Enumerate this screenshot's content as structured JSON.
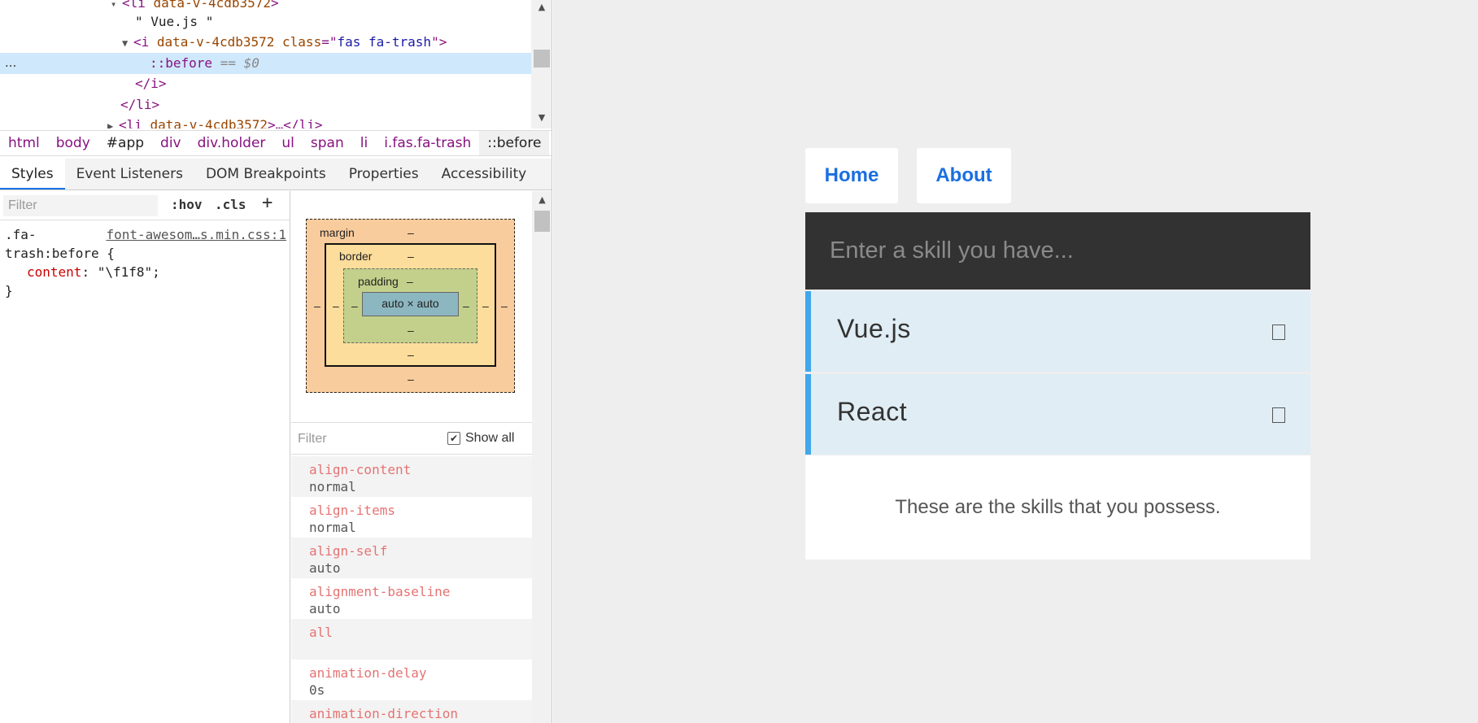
{
  "devtools": {
    "tree": {
      "line0": {
        "tag": "<li ",
        "attr": "data-v-4cdb3572",
        "end": ">"
      },
      "line1": {
        "text": "\" Vue.js \""
      },
      "line2": {
        "open": "<i ",
        "attr1": "data-v-4cdb3572 ",
        "attr2": "class",
        "eq": "=\"",
        "val": "fas fa-trash",
        "close": "\">"
      },
      "line3": {
        "dots": "...",
        "pseudo": "::before",
        "eq": " == ",
        "var": "$0"
      },
      "line4": {
        "text": "</i>"
      },
      "line5": {
        "text": "</li>"
      },
      "line6": {
        "tag": "<li ",
        "attr": "data-v-4cdb3572",
        "end": ">…</li>"
      }
    },
    "breadcrumb": [
      "html",
      "body",
      "#app",
      "div",
      "div.holder",
      "ul",
      "span",
      "li",
      "i.fas.fa-trash",
      "::before"
    ],
    "tabs": [
      "Styles",
      "Event Listeners",
      "DOM Breakpoints",
      "Properties",
      "Accessibility"
    ],
    "styles": {
      "filter_placeholder": "Filter",
      "hov": ":hov",
      "cls": ".cls",
      "add": "+",
      "rule": {
        "selector_line1": ".fa-",
        "selector_line2": "trash:before {",
        "source": "font-awesom…s.min.css:1",
        "prop": "content",
        "value": ": \"\\f1f8\";",
        "close": "}"
      }
    },
    "box_model": {
      "margin": "margin",
      "border": "border",
      "padding": "padding",
      "content": "auto × auto",
      "dash": "–"
    },
    "computed": {
      "filter_placeholder": "Filter",
      "show_all": "Show all",
      "properties": [
        {
          "name": "align-content",
          "value": "normal"
        },
        {
          "name": "align-items",
          "value": "normal"
        },
        {
          "name": "align-self",
          "value": "auto"
        },
        {
          "name": "alignment-baseline",
          "value": "auto"
        },
        {
          "name": "all",
          "value": ""
        },
        {
          "name": "animation-delay",
          "value": "0s"
        },
        {
          "name": "animation-direction",
          "value": ""
        }
      ]
    }
  },
  "page": {
    "nav": {
      "home": "Home",
      "about": "About"
    },
    "input_placeholder": "Enter a skill you have...",
    "skills": [
      "Vue.js",
      "React"
    ],
    "footer": "These are the skills that you possess.",
    "colors": {
      "accent": "#42a6ea",
      "link": "#1a6fe0",
      "input_bg": "#323232"
    }
  }
}
